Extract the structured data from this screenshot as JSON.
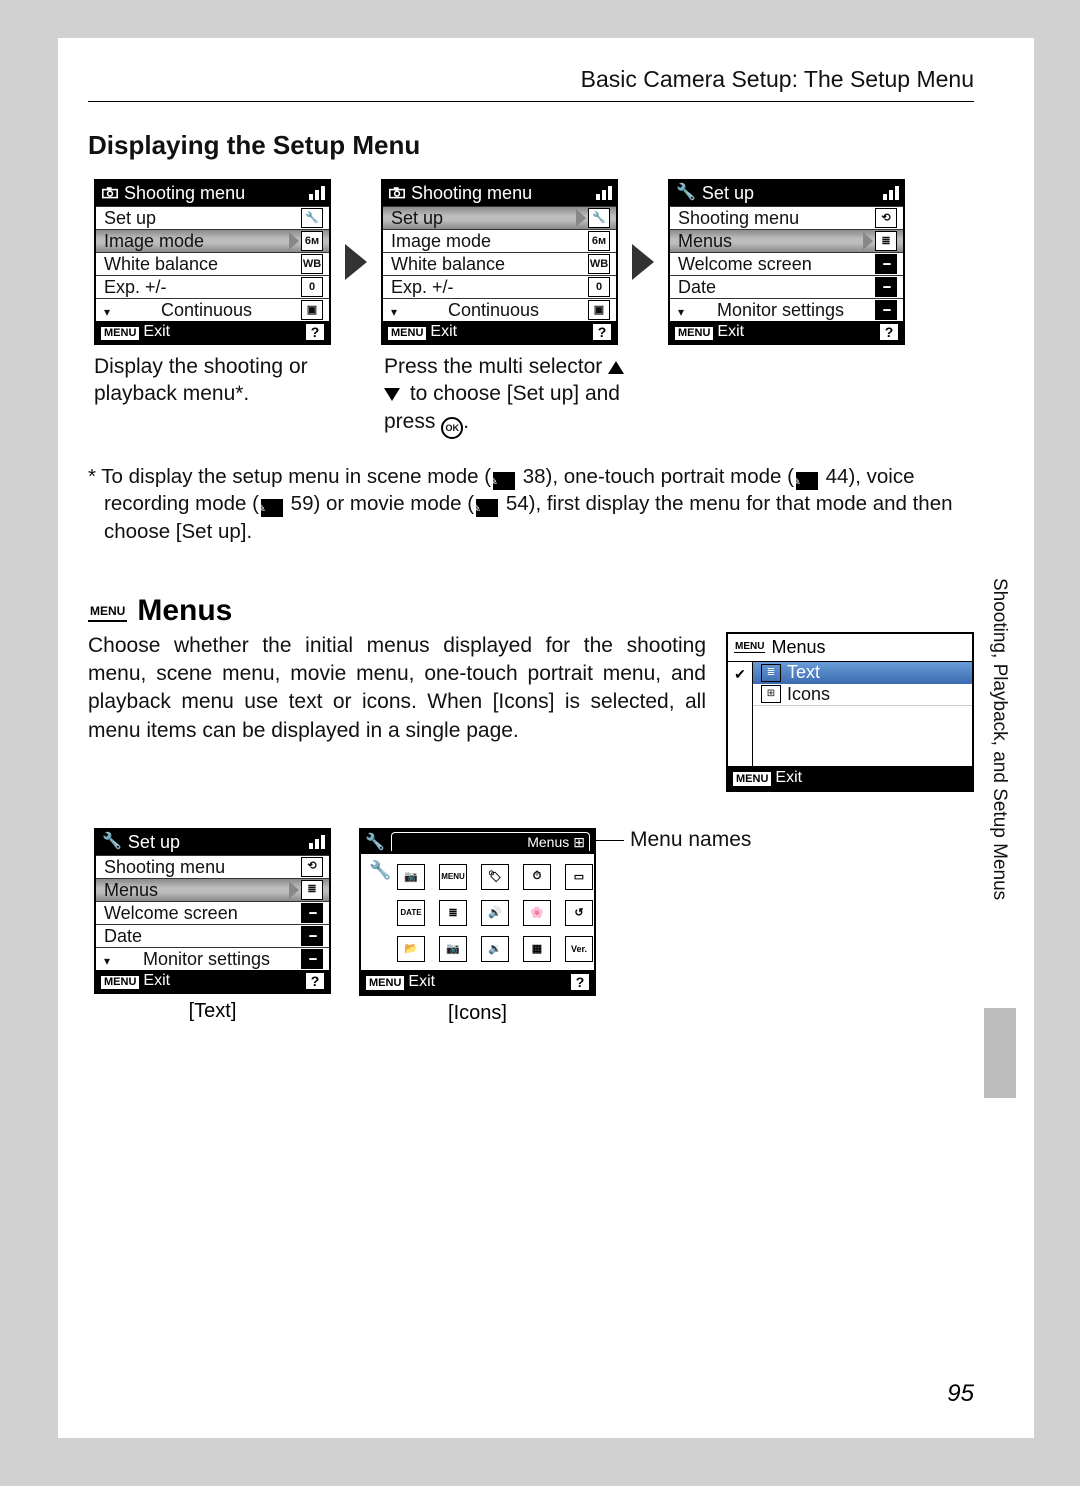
{
  "header": "Basic Camera Setup: The Setup Menu",
  "section_title": "Displaying the Setup Menu",
  "page_number": "95",
  "side_text": "Shooting, Playback, and Setup Menus",
  "lcd1": {
    "title": "Shooting menu",
    "rows": [
      {
        "label": "Set up",
        "icon": "🔧"
      },
      {
        "label": "Image mode",
        "icon": "6ᴍ",
        "hl": true
      },
      {
        "label": "White balance",
        "icon": "WB"
      },
      {
        "label": "Exp. +/-",
        "icon": "0"
      },
      {
        "label": "Continuous",
        "icon": "▣",
        "scroll": true
      }
    ],
    "footer_exit": "Exit",
    "footer_menu": "MENU",
    "footer_help": "?"
  },
  "lcd2": {
    "title": "Shooting menu",
    "rows": [
      {
        "label": "Set up",
        "icon": "🔧",
        "hl": true
      },
      {
        "label": "Image mode",
        "icon": "6ᴍ"
      },
      {
        "label": "White balance",
        "icon": "WB"
      },
      {
        "label": "Exp. +/-",
        "icon": "0"
      },
      {
        "label": "Continuous",
        "icon": "▣",
        "scroll": true
      }
    ],
    "footer_exit": "Exit",
    "footer_menu": "MENU",
    "footer_help": "?"
  },
  "lcd3": {
    "title": "Set up",
    "rows": [
      {
        "label": "Shooting menu",
        "icon": "⟲"
      },
      {
        "label": "Menus",
        "icon": "≣",
        "hl": true
      },
      {
        "label": "Welcome screen",
        "dash": true
      },
      {
        "label": "Date",
        "dash": true
      },
      {
        "label": "Monitor settings",
        "dash": true,
        "scroll": true
      }
    ],
    "footer_exit": "Exit",
    "footer_menu": "MENU",
    "footer_help": "?"
  },
  "caption1": "Display the shooting or playback menu*.",
  "caption2_a": "Press the multi selector ",
  "caption2_b": " to choose [Set up] and press ",
  "caption2_ok": "OK",
  "caption2_end": ".",
  "footnote_a": "* To display the setup menu in scene mode (",
  "footnote_p1": "38), one-touch portrait mode (",
  "footnote_p2": "44), voice recording mode (",
  "footnote_p3": "59) or movie mode (",
  "footnote_p4": "54), first display the menu for that mode and then choose [Set up].",
  "menus_heading": "Menus",
  "menus_heading_tag": "MENU",
  "menus_paragraph": "Choose whether the initial menus displayed for the shooting menu, scene menu, movie menu, one-touch portrait menu, and playback menu use text or icons. When [Icons] is selected, all menu items can be displayed in a single page.",
  "small_lcd": {
    "title": "Menus",
    "title_tag": "MENU",
    "left_icon": "✔",
    "rows": [
      {
        "label": "Text",
        "sel": true,
        "icon": "≣"
      },
      {
        "label": "Icons",
        "icon": "⊞"
      }
    ],
    "footer_exit": "Exit",
    "footer_menu": "MENU"
  },
  "bottom_setup": {
    "title": "Set up",
    "rows": [
      {
        "label": "Shooting menu",
        "icon": "⟲"
      },
      {
        "label": "Menus",
        "icon": "≣",
        "hl": true
      },
      {
        "label": "Welcome screen",
        "dash": true
      },
      {
        "label": "Date",
        "dash": true
      },
      {
        "label": "Monitor settings",
        "dash": true,
        "scroll": true
      }
    ],
    "footer_exit": "Exit",
    "footer_menu": "MENU",
    "footer_help": "?",
    "caption": "[Text]"
  },
  "icons_lcd": {
    "tab_label": "Menus",
    "grid_labels": [
      "📷",
      "MENU",
      "🏷",
      "⏱",
      "▭",
      "DATE",
      "≣",
      "🔊",
      "🌸",
      "↺",
      "📂",
      "📷",
      "🔉",
      "▦",
      "Ver."
    ],
    "footer_exit": "Exit",
    "footer_menu": "MENU",
    "footer_help": "?",
    "caption": "[Icons]"
  },
  "menu_names_label": "Menu names"
}
